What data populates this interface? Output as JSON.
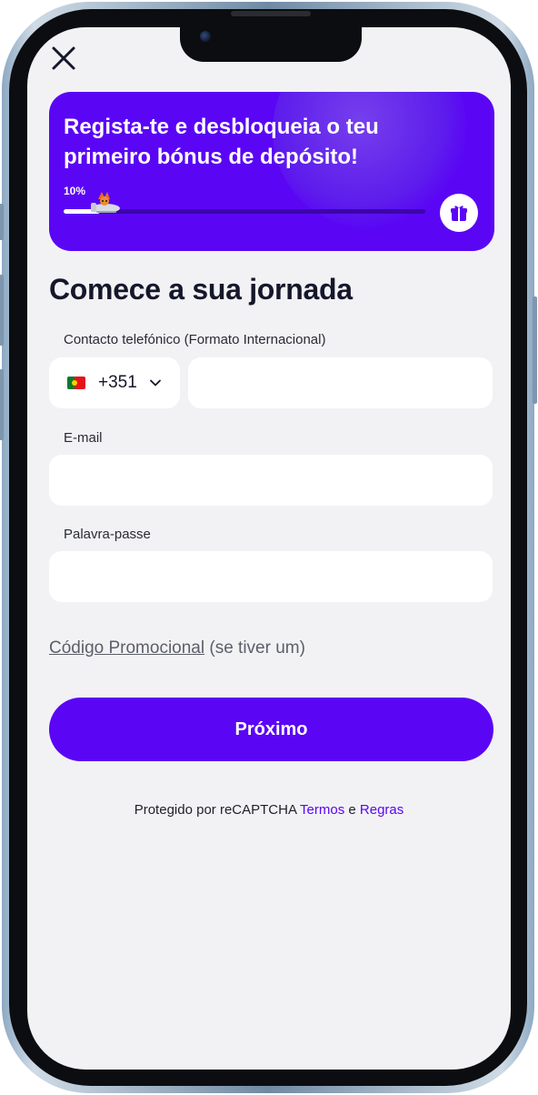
{
  "close": {
    "icon": "close-icon"
  },
  "banner": {
    "title": "Regista-te e desbloqueia o teu primeiro bónus de depósito!",
    "progress_label": "10%",
    "progress_value": 0.1,
    "gift_icon": "gift-icon",
    "background_color": "#5a06f5"
  },
  "form": {
    "heading": "Comece a sua jornada",
    "phone": {
      "label": "Contacto telefónico (Formato Internacional)",
      "country_code": "+351",
      "country_flag": "portugal-flag-icon",
      "value": "",
      "placeholder": ""
    },
    "email": {
      "label": "E-mail",
      "value": "",
      "placeholder": ""
    },
    "password": {
      "label": "Palavra-passe",
      "value": "",
      "placeholder": ""
    },
    "promo": {
      "link_text": "Código Promocional",
      "suffix": " (se tiver um)"
    },
    "submit_label": "Próximo"
  },
  "footer": {
    "captcha_text": "Protegido por reCAPTCHA ",
    "terms_label": "Termos",
    "and_text": " e ",
    "rules_label": "Regras"
  },
  "colors": {
    "accent": "#5a06f5",
    "screen_bg": "#f2f2f5",
    "text": "#15172a"
  }
}
